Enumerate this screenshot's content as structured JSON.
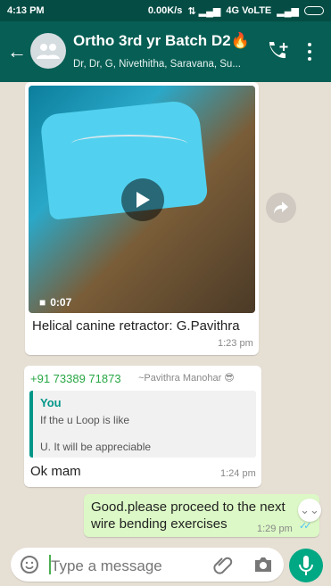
{
  "status": {
    "time": "4:13 PM",
    "network": "0.00K/s",
    "connection": "4G VoLTE"
  },
  "header": {
    "title": "Ortho 3rd yr Batch D2🔥",
    "subtitle": "Dr, Dr, G, Nivethitha, Saravana, Su...",
    "back_icon": "back-arrow-icon",
    "call_icon": "add-call-icon",
    "menu_icon": "more-vert-icon"
  },
  "messages": {
    "video": {
      "duration": "0:07",
      "caption": "Helical canine  retractor: G.Pavithra",
      "time": "1:23 pm"
    },
    "reply": {
      "sender": "+91 73389 71873",
      "sender_name": "~Pavithra Manohar 😎",
      "quoted_author": "You",
      "quoted_line1": "If the u Loop is like",
      "quoted_line2": "U. It will be appreciable",
      "text": "Ok mam",
      "time": "1:24 pm"
    },
    "outgoing": {
      "text": "Good.please proceed to the next wire bending exercises",
      "time": "1:29 pm"
    }
  },
  "composer": {
    "placeholder": "Type a message"
  },
  "colors": {
    "header": "#075e54",
    "outgoing_bubble": "#dcf8c6",
    "accent": "#00a884"
  }
}
